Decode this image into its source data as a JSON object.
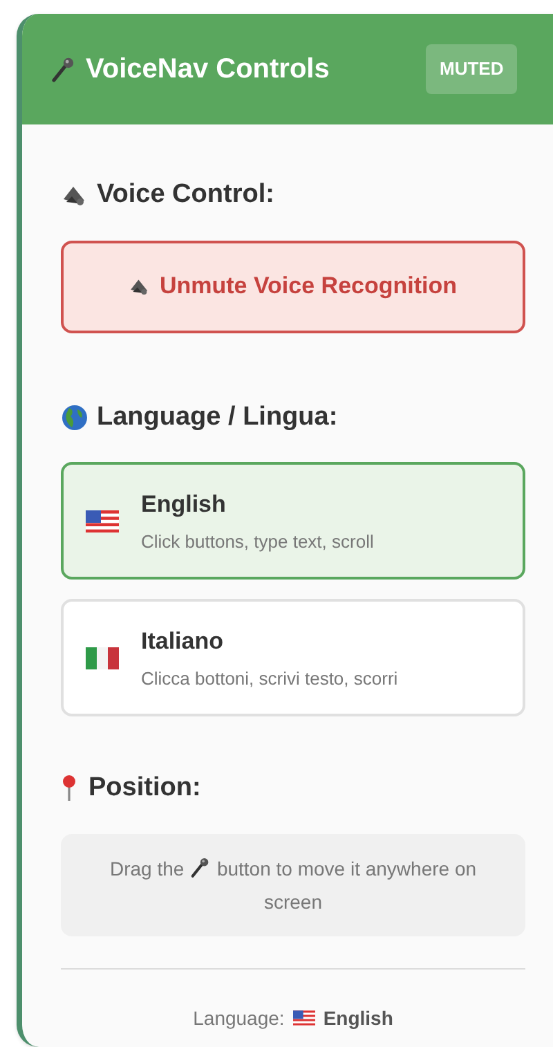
{
  "header": {
    "title": "VoiceNav Controls",
    "badge": "MUTED"
  },
  "voice_control": {
    "heading": "Voice Control:",
    "button": "Unmute Voice Recognition"
  },
  "language": {
    "heading": "Language / Lingua:",
    "options": [
      {
        "name": "English",
        "description": "Click buttons, type text, scroll",
        "kind": "us",
        "selected": true
      },
      {
        "name": "Italiano",
        "description": "Clicca bottoni, scrivi testo, scorri",
        "kind": "it",
        "selected": false
      }
    ]
  },
  "position": {
    "heading": "Position:",
    "hint_before": "Drag the",
    "hint_after": "button to move it anywhere on screen"
  },
  "footer": {
    "label": "Language:",
    "kind": "us",
    "value": "English"
  }
}
